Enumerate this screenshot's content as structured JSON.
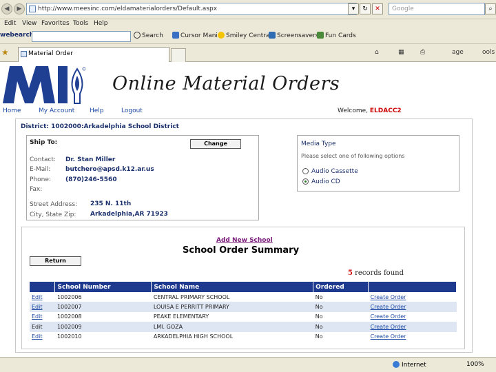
{
  "browser": {
    "url": "http://www.meesinc.com/eldamaterialorders/Default.aspx",
    "search_placeholder": "Google",
    "menu": [
      "Edit",
      "View",
      "Favorites",
      "Tools",
      "Help"
    ],
    "toolbar_brand": "webearch",
    "toolbar_items": [
      "Search",
      "Cursor Mania",
      "Smiley Central",
      "Screensavers",
      "Fun Cards"
    ],
    "tab_title": "Material Order",
    "tab_tools": [
      "age",
      "ools"
    ],
    "status_zone": "Internet",
    "zoom": "100%"
  },
  "header": {
    "title": "Online Material Orders",
    "nav": [
      "Home",
      "My Account",
      "Help",
      "Logout"
    ],
    "welcome_label": "Welcome,",
    "welcome_user": "ELDACC2"
  },
  "district": "District: 1002000:Arkadelphia School District",
  "ship_to": {
    "title": "Ship To:",
    "change_label": "Change",
    "contact_label": "Contact:",
    "contact": "Dr. Stan Miller",
    "email_label": "E-Mail:",
    "email": "butchero@apsd.k12.ar.us",
    "phone_label": "Phone:",
    "phone": "(870)246-5560",
    "fax_label": "Fax:",
    "street_label": "Street Address:",
    "street": "235 N. 11th",
    "city_label": "City, State Zip:",
    "city": "Arkadelphia,AR 71923"
  },
  "media": {
    "title": "Media Type",
    "subtitle": "Please select one of following options",
    "options": [
      {
        "label": "Audio Cassette",
        "selected": false
      },
      {
        "label": "Audio CD",
        "selected": true
      }
    ]
  },
  "orders": {
    "add_label": "Add New School",
    "title": "School Order Summary",
    "return_label": "Return",
    "records_count": "5",
    "records_text": "records found",
    "columns": [
      "",
      "School Number",
      "School Name",
      "Ordered",
      ""
    ],
    "rows": [
      {
        "edit": "Edit",
        "number": "1002006",
        "name": "CENTRAL PRIMARY SCHOOL",
        "ordered": "No",
        "action": "Create Order"
      },
      {
        "edit": "Edit",
        "number": "1002007",
        "name": "LOUISA E PERRITT PRIMARY",
        "ordered": "No",
        "action": "Create Order"
      },
      {
        "edit": "Edit",
        "number": "1002008",
        "name": "PEAKE ELEMENTARY",
        "ordered": "No",
        "action": "Create Order"
      },
      {
        "edit": "Edit",
        "number": "1002009",
        "name": "LMI. GOZA",
        "ordered": "No",
        "action": "Create Order"
      },
      {
        "edit": "Edit",
        "number": "1002010",
        "name": "ARKADELPHIA HIGH SCHOOL",
        "ordered": "No",
        "action": "Create Order"
      }
    ]
  }
}
